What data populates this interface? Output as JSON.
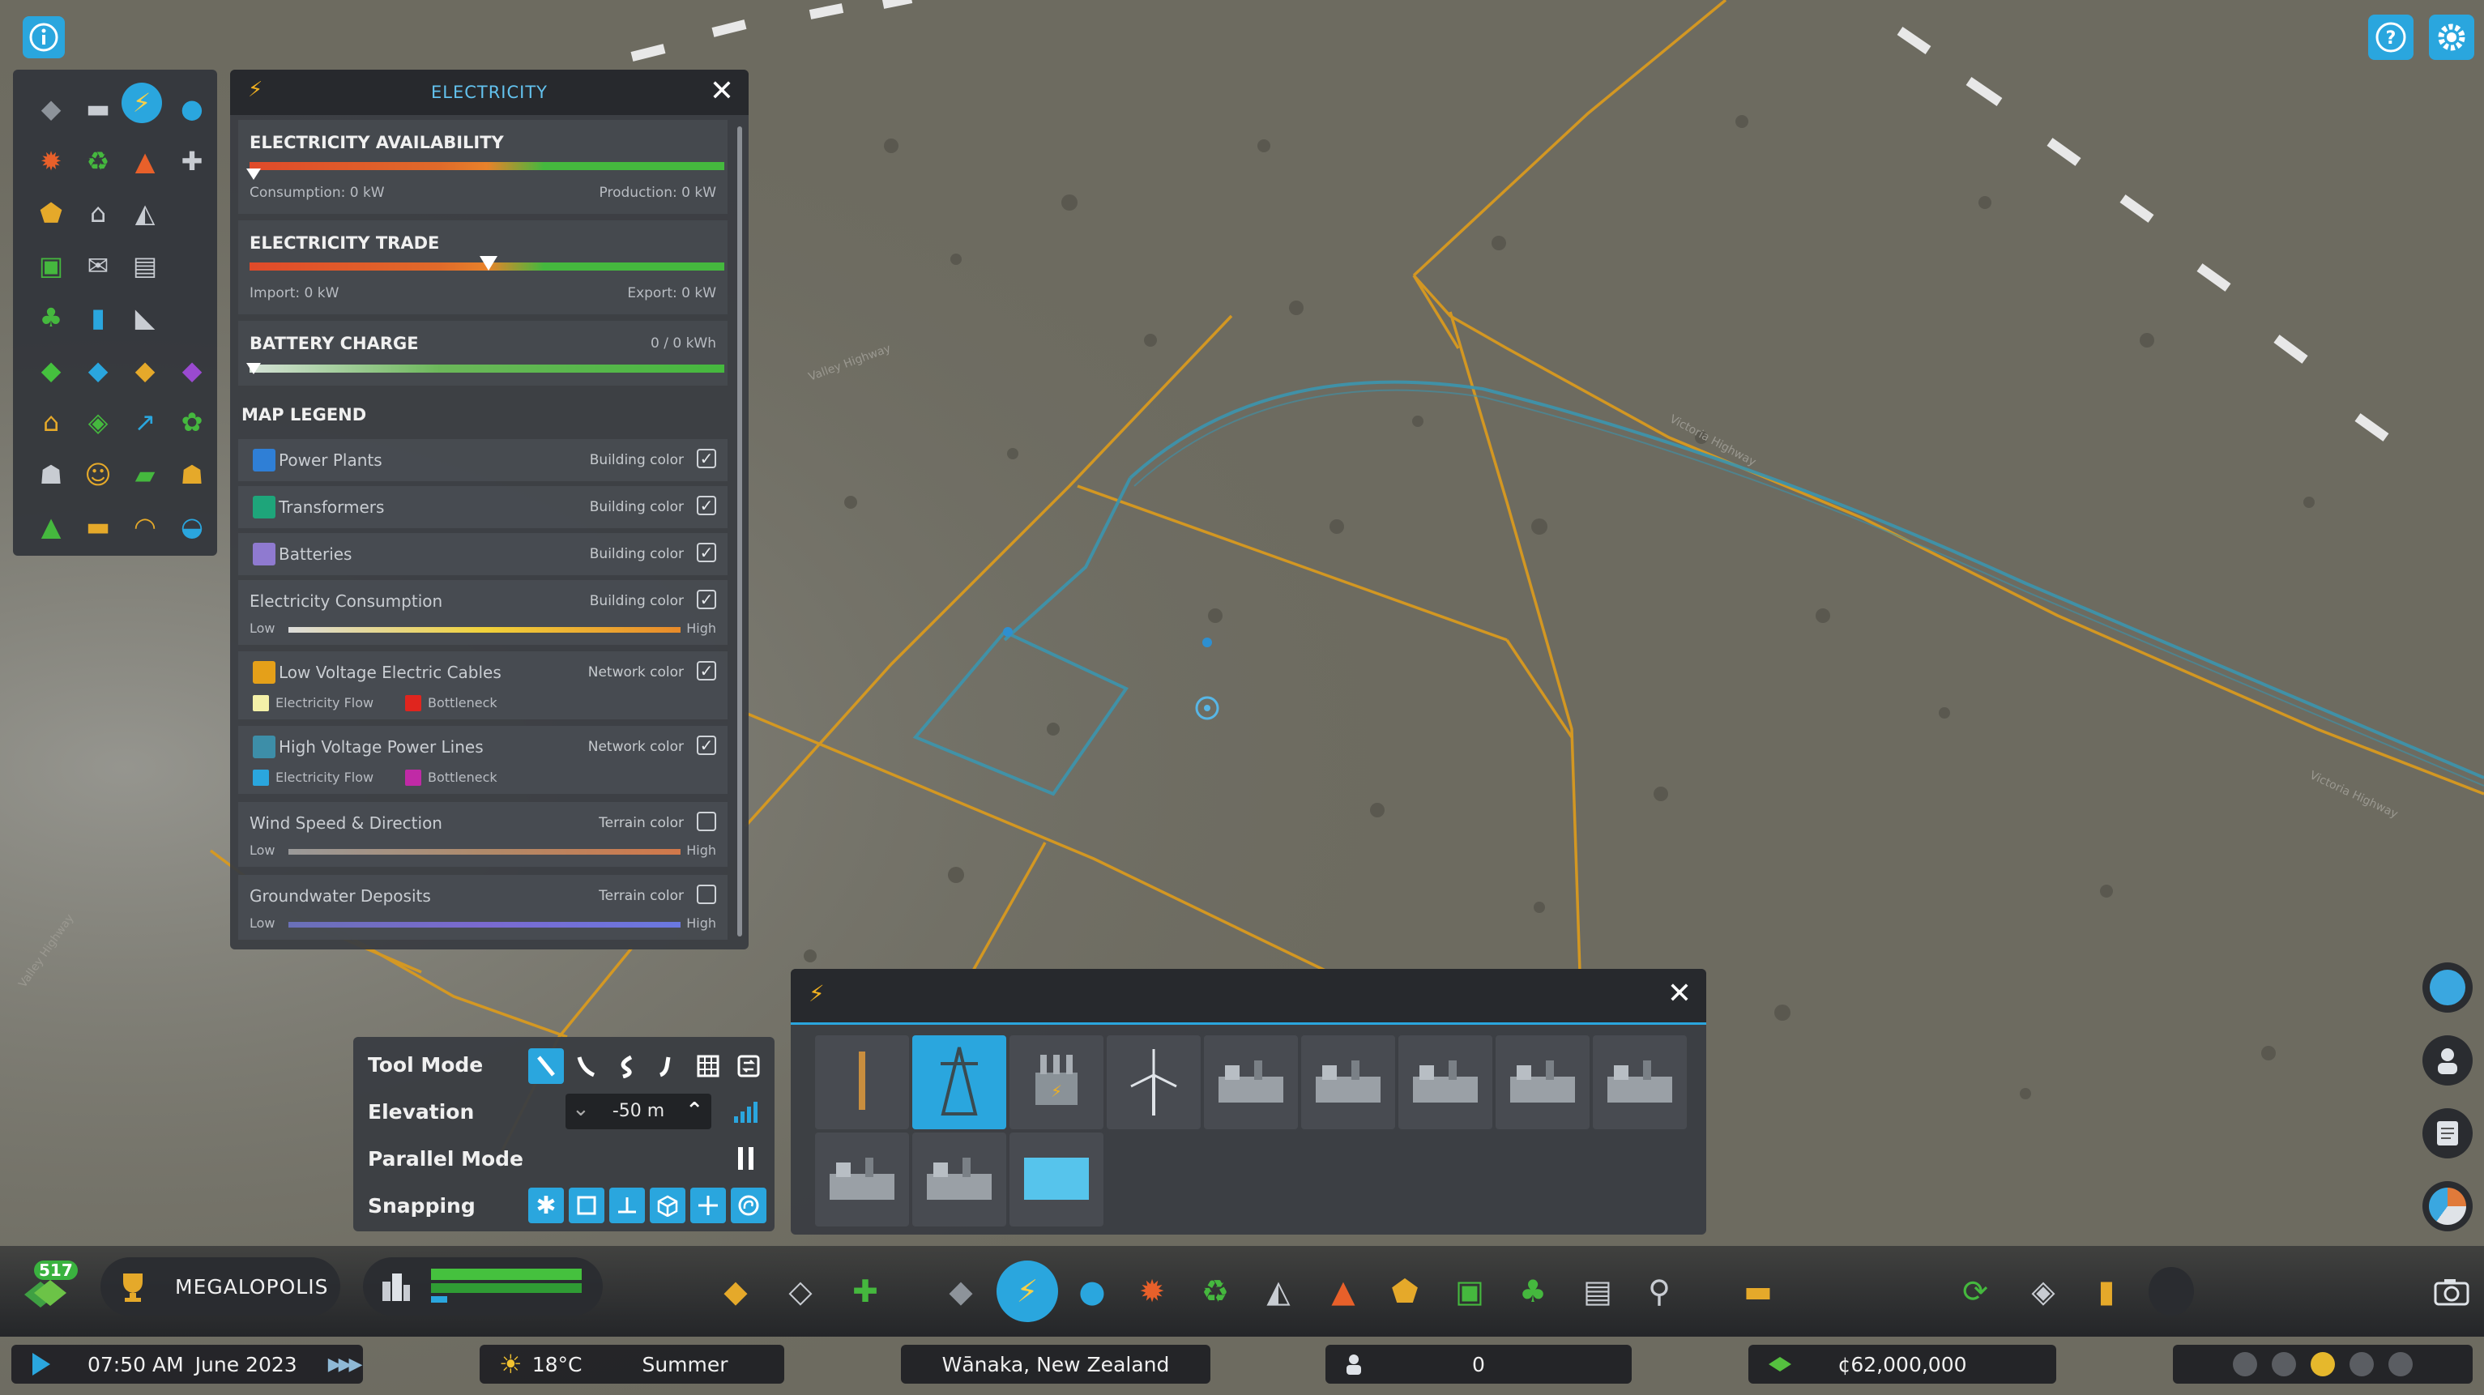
{
  "electricity_panel": {
    "title": "ELECTRICITY",
    "availability": {
      "label": "ELECTRICITY AVAILABILITY",
      "consumption": "Consumption: 0 kW",
      "production": "Production: 0 kW"
    },
    "trade": {
      "label": "ELECTRICITY TRADE",
      "import": "Import: 0 kW",
      "export": "Export: 0 kW"
    },
    "battery": {
      "label": "BATTERY CHARGE",
      "value": "0 / 0 kWh"
    },
    "map_legend_title": "MAP LEGEND",
    "legend": [
      {
        "label": "Power Plants",
        "type": "Building color",
        "checked": true,
        "color": "#2f7fd6"
      },
      {
        "label": "Transformers",
        "type": "Building color",
        "checked": true,
        "color": "#1ea57a"
      },
      {
        "label": "Batteries",
        "type": "Building color",
        "checked": true,
        "color": "#8f7ad0"
      },
      {
        "label": "Electricity Consumption",
        "type": "Building color",
        "checked": true,
        "low": "Low",
        "high": "High"
      },
      {
        "label": "Low Voltage Electric Cables",
        "type": "Network color",
        "checked": true,
        "color": "#e5a019",
        "flow": "Electricity Flow",
        "bottleneck": "Bottleneck"
      },
      {
        "label": "High Voltage Power Lines",
        "type": "Network color",
        "checked": true,
        "color": "#3d8ea8",
        "flow": "Electricity Flow",
        "bottleneck": "Bottleneck"
      },
      {
        "label": "Wind Speed & Direction",
        "type": "Terrain color",
        "checked": false,
        "low": "Low",
        "high": "High"
      },
      {
        "label": "Groundwater Deposits",
        "type": "Terrain color",
        "checked": false,
        "low": "Low",
        "high": "High"
      }
    ]
  },
  "tool_panel": {
    "tool_mode": "Tool Mode",
    "elevation": "Elevation",
    "elevation_value": "-50 m",
    "parallel_mode": "Parallel Mode",
    "snapping": "Snapping"
  },
  "city": {
    "milestone": "517",
    "name": "MEGALOPOLIS"
  },
  "status_bar": {
    "time": "07:50 AM",
    "date": "June 2023",
    "temperature": "18°C",
    "season": "Summer",
    "location": "Wānaka, New Zealand",
    "population": "0",
    "money": "¢62,000,000"
  },
  "map_labels": [
    "Valley Highway",
    "Victoria Highway",
    "Valley Highway",
    "Victoria Highway"
  ],
  "colors": {
    "accent": "#2aa6de",
    "panel": "#34373c",
    "low_voltage": "#e5a019",
    "high_voltage": "#3d8ea8"
  }
}
